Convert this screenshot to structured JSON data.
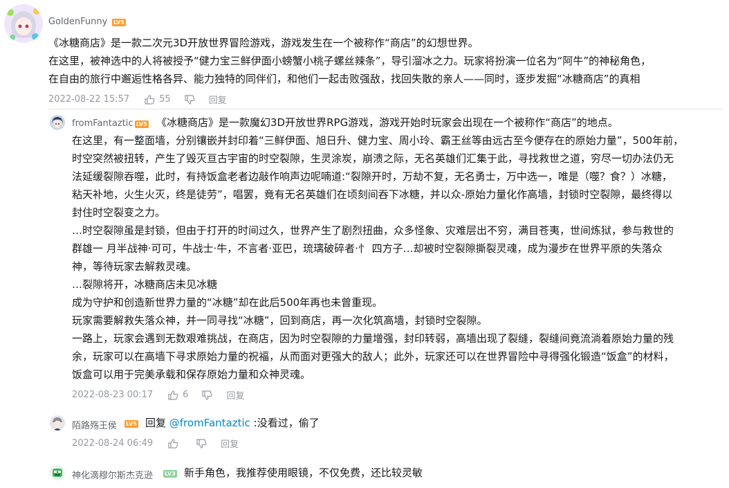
{
  "colors": {
    "level5": "#ff9c2b",
    "level3": "#8bd29b",
    "mention": "#008ac5",
    "meta": "#9499a0"
  },
  "comments": [
    {
      "user": "GoldenFunny",
      "level": "LV5",
      "lines": [
        "《冰糖商店》是一款二次元3D开放世界冒险游戏，游戏发生在一个被称作“商店”的幻想世界。",
        "在这里，被神选中的人将被授予“健力宝三鲜伊面小螃蟹小桃子螺丝辣条”，导引溜冰之力。玩家将扮演一位名为“阿牛”的神秘角色，",
        "在自由的旅行中邂逅性格各异、能力独特的同伴们，和他们一起击败强敌，找回失散的亲人——同时，逐步发掘“冰糖商店”的真相"
      ],
      "time": "2022-08-22 15:57",
      "likes": "55",
      "reply": "回复"
    },
    {
      "user": "fromFantaztic",
      "level": "LV5",
      "lines": [
        "《冰糖商店》是一款魔幻3D开放世界RPG游戏，游戏开始时玩家会出现在一个被称作“商店”的地点。",
        "在这里，有一整面墙，分别镶嵌并封印着“三鲜伊面、旭日升、健力宝、周小玲、霸王丝等由远古至今便存在的原始力量”，500年前，",
        "时空突然被扭转，产生了毁灭亘古宇宙的时空裂隙，生灵涂炭，崩溃之际，无名英雄们汇集于此，寻找救世之道，穷尽一切办法仍无",
        "法延缓裂隙吞噬，此时，有持饭盒老者边敲作响声边呢喃道:“裂隙开时，万劫不复，无名勇士，万中选一，唯是（噬？食？）冰糖，",
        "粘天补地，火生火灭，终是徒劳”，唱罢，竟有无名英雄们在顷刻间吞下冰糖，并以众-原始力量化作高墙，封锁时空裂隙，最终得以",
        "封住时空裂变之力。",
        "…时空裂隙虽是封锁，但由于打开的时间过久，世界产生了剧烈扭曲，众多怪象、灾难层出不穷，满目苍夷，世间炼狱，参与救世的",
        "群雄一 月半战神·可可，牛战士·牛，不言者·亚巴，琉璃破碎者·忄 四方子…却被时空裂隙撕裂灵魂，成为漫步在世界平原的失落众",
        "神，等待玩家去解救灵魂。",
        "…裂隙将开，冰糖商店未见冰糖",
        "成为守护和创造新世界力量的“冰糖”却在此后500年再也未曾重现。",
        "玩家需要解救失落众神，并一同寻找“冰糖”，回到商店，再一次化筑高墙，封锁时空裂隙。",
        "一路上，玩家会遇到无数艰难挑战，在商店，因为时空裂隙的力量增强，封印转弱，高墙出现了裂缝，裂缝间竟流淌着原始力量的残",
        "余，玩家可以在高墙下寻求原始力量的祝福，从而面对更强大的敌人；此外，玩家还可以在世界冒险中寻得强化锻造“饭盒”的材料，",
        "饭盒可以用于完美承载和保存原始力量和众神灵魂。"
      ],
      "time": "2022-08-23 00:17",
      "likes": "6",
      "reply": "回复"
    },
    {
      "user": "陌路殇王侯",
      "level": "LV5",
      "reply_prefix": "回复 ",
      "mention": "@fromFantaztic",
      "text": " :没看过，偷了",
      "time": "2022-08-24 06:49",
      "likes": "",
      "reply": "回复"
    },
    {
      "user": "神化滴穆尔斯杰克逊",
      "level": "LV3",
      "text": "新手角色，我推荐使用眼镜，不仅免费，还比较灵敏"
    }
  ],
  "icons": [
    "thumbs-up-icon",
    "thumbs-down-icon"
  ]
}
